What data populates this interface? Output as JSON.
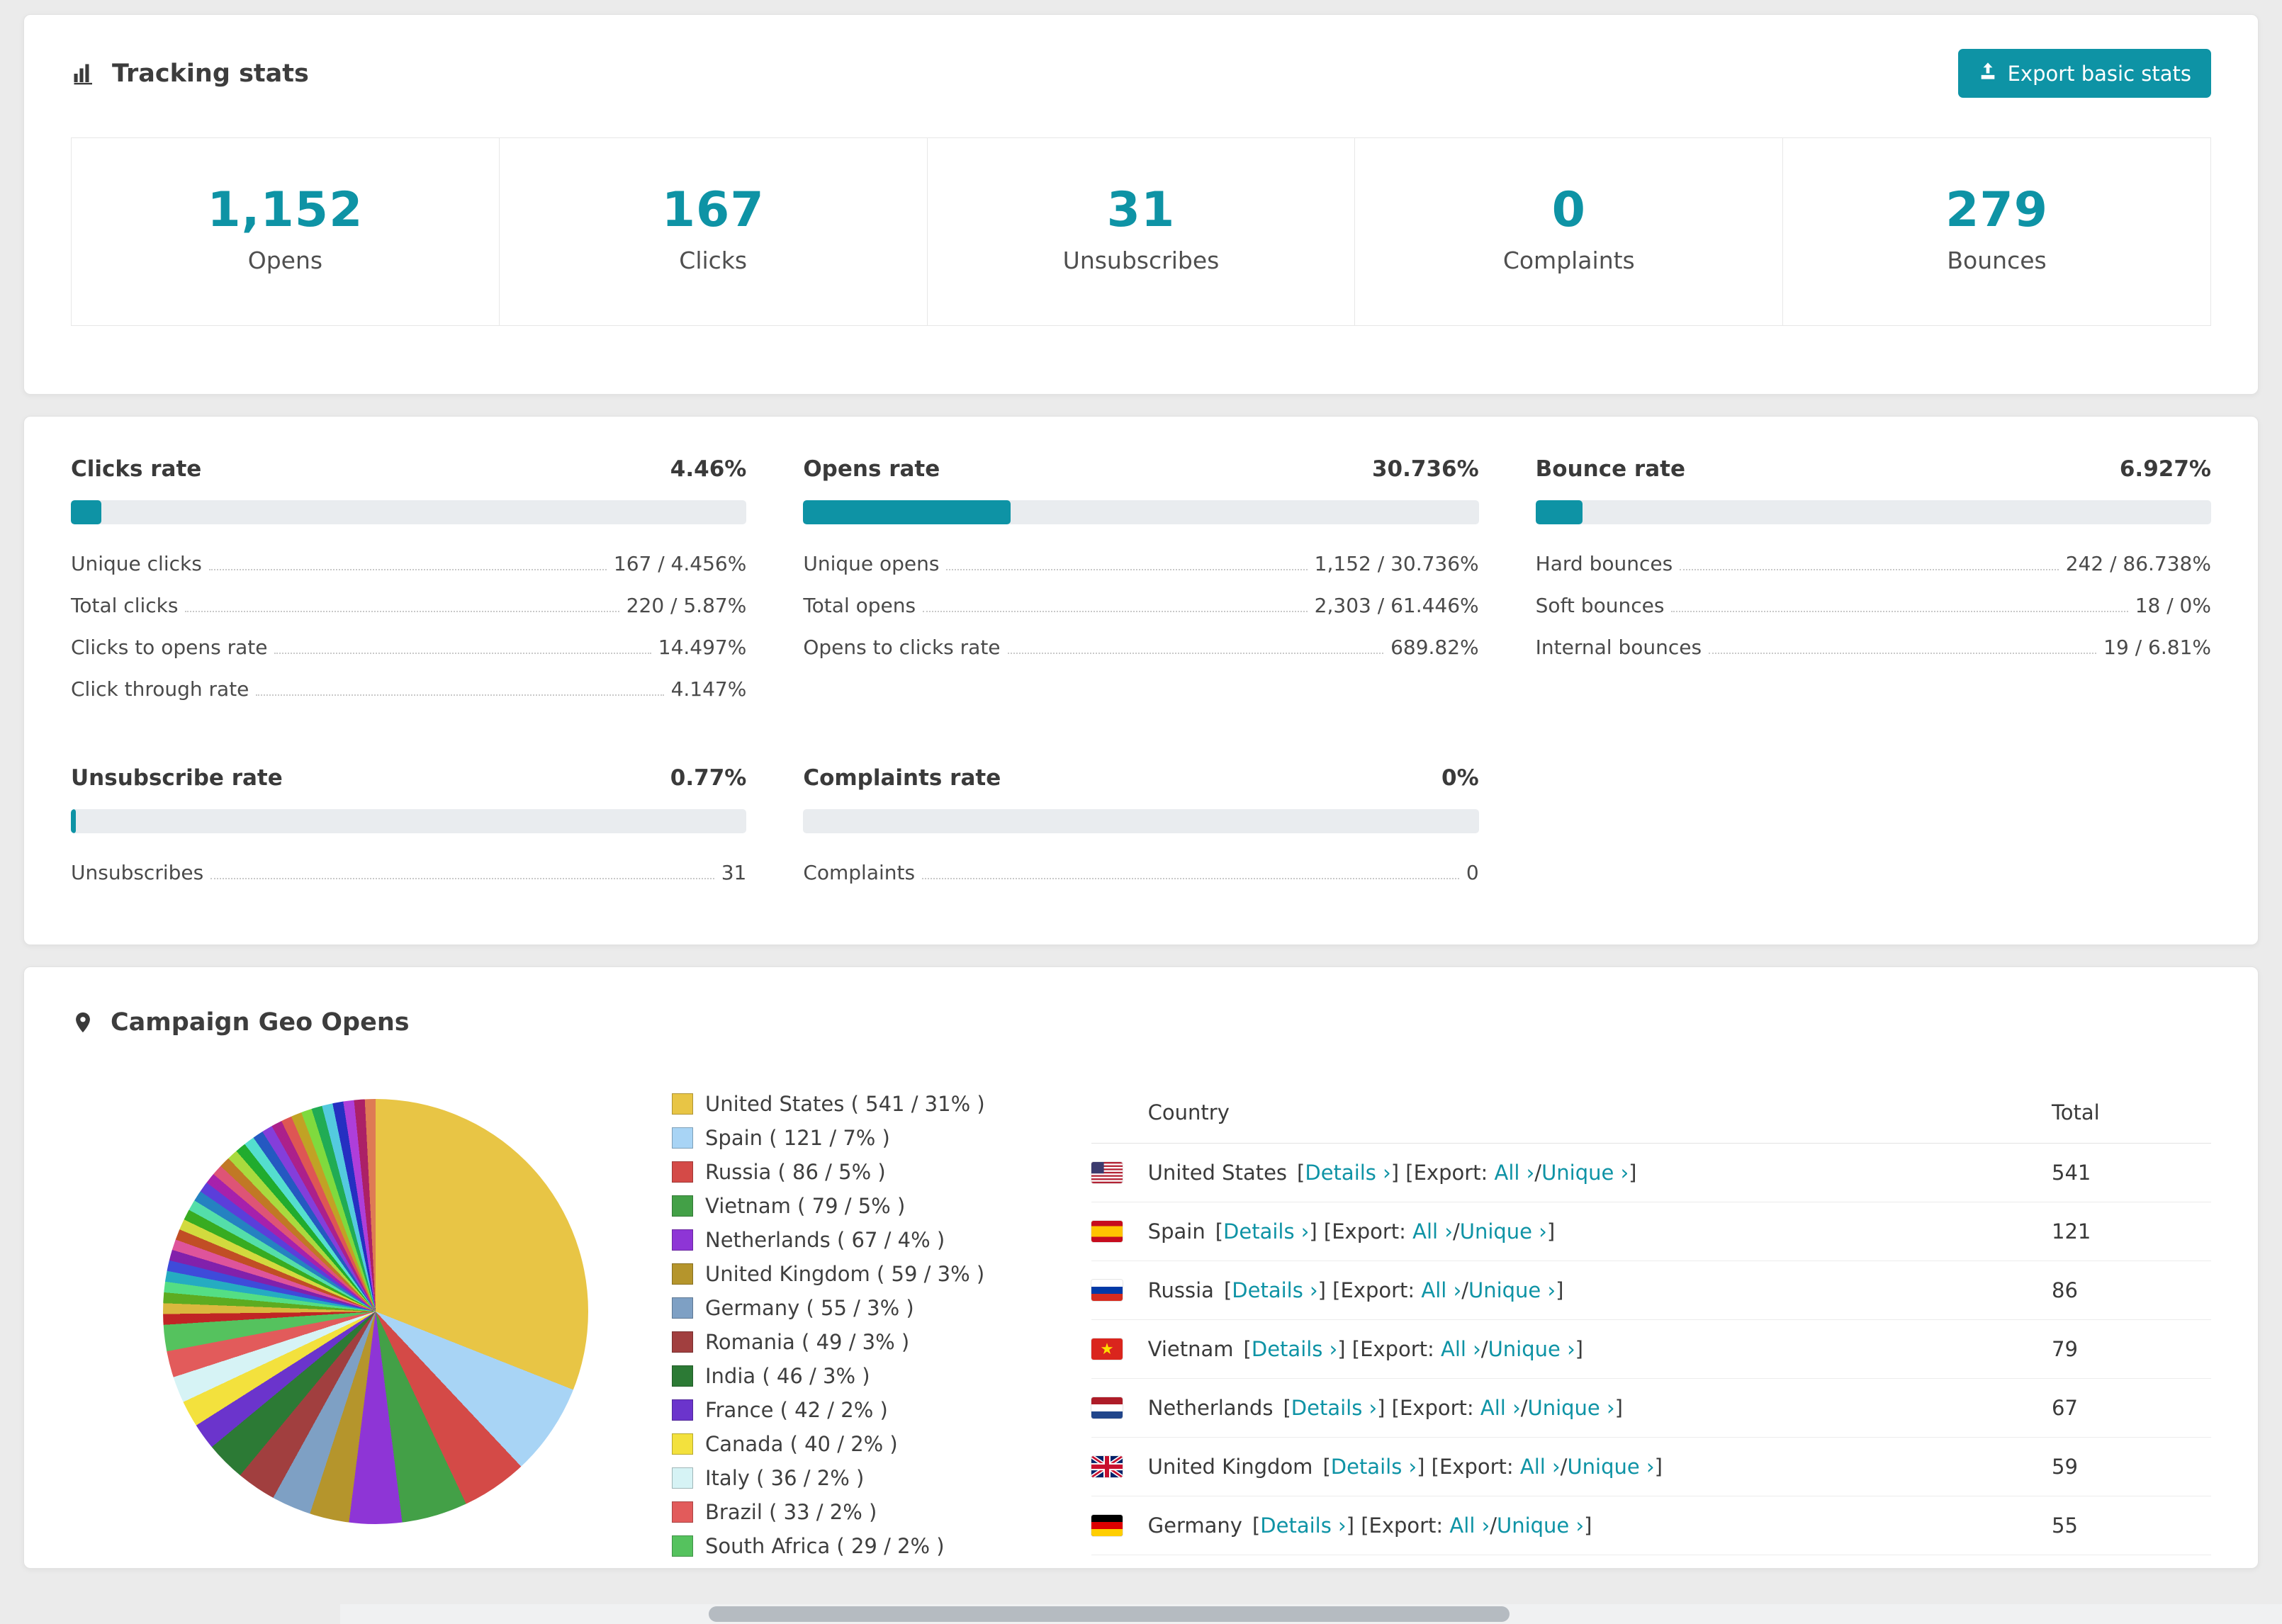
{
  "colors": {
    "accent": "#0e93a5"
  },
  "tracking": {
    "title": "Tracking stats",
    "export_button": "Export basic stats",
    "stats": [
      {
        "value": "1,152",
        "label": "Opens"
      },
      {
        "value": "167",
        "label": "Clicks"
      },
      {
        "value": "31",
        "label": "Unsubscribes"
      },
      {
        "value": "0",
        "label": "Complaints"
      },
      {
        "value": "279",
        "label": "Bounces"
      }
    ]
  },
  "rates": [
    {
      "title": "Clicks rate",
      "value": "4.46%",
      "percent": 4.46,
      "rows": [
        {
          "label": "Unique clicks",
          "value": "167 / 4.456%"
        },
        {
          "label": "Total clicks",
          "value": "220 / 5.87%"
        },
        {
          "label": "Clicks to opens rate",
          "value": "14.497%"
        },
        {
          "label": "Click through rate",
          "value": "4.147%"
        }
      ]
    },
    {
      "title": "Opens rate",
      "value": "30.736%",
      "percent": 30.736,
      "rows": [
        {
          "label": "Unique opens",
          "value": "1,152 / 30.736%"
        },
        {
          "label": "Total opens",
          "value": "2,303 / 61.446%"
        },
        {
          "label": "Opens to clicks rate",
          "value": "689.82%"
        }
      ]
    },
    {
      "title": "Bounce rate",
      "value": "6.927%",
      "percent": 6.927,
      "rows": [
        {
          "label": "Hard bounces",
          "value": "242 / 86.738%"
        },
        {
          "label": "Soft bounces",
          "value": "18 / 0%"
        },
        {
          "label": "Internal bounces",
          "value": "19 / 6.81%"
        }
      ]
    },
    {
      "title": "Unsubscribe rate",
      "value": "0.77%",
      "percent": 0.77,
      "rows": [
        {
          "label": "Unsubscribes",
          "value": "31"
        }
      ]
    },
    {
      "title": "Complaints rate",
      "value": "0%",
      "percent": 0,
      "rows": [
        {
          "label": "Complaints",
          "value": "0"
        }
      ]
    }
  ],
  "geo": {
    "title": "Campaign Geo Opens",
    "table": {
      "headers": {
        "country": "Country",
        "total": "Total"
      },
      "links": {
        "open_bracket": "[",
        "close_bracket": "]",
        "details": "Details ›",
        "export": "Export:",
        "all": "All ›",
        "slash": "/",
        "unique": "Unique ›"
      },
      "rows": [
        {
          "country": "United States",
          "flag": "us",
          "total": "541"
        },
        {
          "country": "Spain",
          "flag": "es",
          "total": "121"
        },
        {
          "country": "Russia",
          "flag": "ru",
          "total": "86"
        },
        {
          "country": "Vietnam",
          "flag": "vn",
          "total": "79"
        },
        {
          "country": "Netherlands",
          "flag": "nl",
          "total": "67"
        },
        {
          "country": "United Kingdom",
          "flag": "gb",
          "total": "59"
        },
        {
          "country": "Germany",
          "flag": "de",
          "total": "55"
        }
      ]
    }
  },
  "chart_data": {
    "type": "pie",
    "title": "Campaign Geo Opens",
    "legend_position": "right",
    "slices": [
      {
        "label": "United States",
        "count": 541,
        "percent": 31,
        "color": "#e8c545"
      },
      {
        "label": "Spain",
        "count": 121,
        "percent": 7,
        "color": "#a8d4f5"
      },
      {
        "label": "Russia",
        "count": 86,
        "percent": 5,
        "color": "#d44a47"
      },
      {
        "label": "Vietnam",
        "count": 79,
        "percent": 5,
        "color": "#43a047"
      },
      {
        "label": "Netherlands",
        "count": 67,
        "percent": 4,
        "color": "#8e35d6"
      },
      {
        "label": "United Kingdom",
        "count": 59,
        "percent": 3,
        "color": "#b5952c"
      },
      {
        "label": "Germany",
        "count": 55,
        "percent": 3,
        "color": "#7ea0c4"
      },
      {
        "label": "Romania",
        "count": 49,
        "percent": 3,
        "color": "#a13f3f"
      },
      {
        "label": "India",
        "count": 46,
        "percent": 3,
        "color": "#2c7a35"
      },
      {
        "label": "France",
        "count": 42,
        "percent": 2,
        "color": "#6b34cc"
      },
      {
        "label": "Canada",
        "count": 40,
        "percent": 2,
        "color": "#f3e13d"
      },
      {
        "label": "Italy",
        "count": 36,
        "percent": 2,
        "color": "#d6f3f5"
      },
      {
        "label": "Brazil",
        "count": 33,
        "percent": 2,
        "color": "#e25b5b"
      },
      {
        "label": "South Africa",
        "count": 29,
        "percent": 2,
        "color": "#55c25e"
      }
    ],
    "others_percent": 26
  }
}
